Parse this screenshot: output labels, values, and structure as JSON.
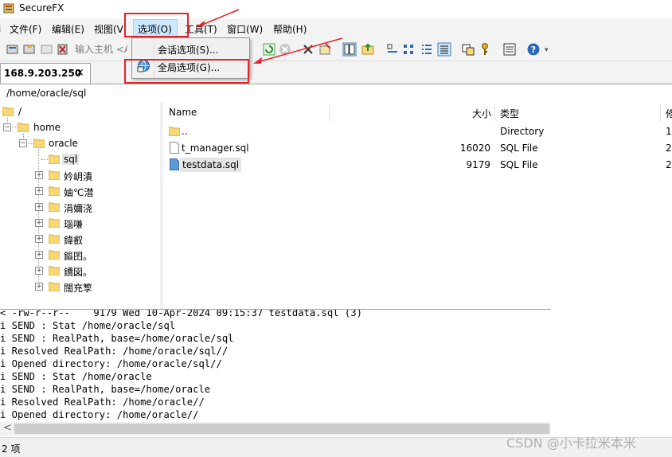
{
  "window": {
    "title": "SecureFX",
    "icon": "securefx-app-icon"
  },
  "menubar": {
    "items": [
      {
        "label": "文件(F)"
      },
      {
        "label": "编辑(E)"
      },
      {
        "label": "视图(V"
      },
      {
        "label": "选项(O)"
      },
      {
        "label": "工具(T)"
      },
      {
        "label": "窗口(W)"
      },
      {
        "label": "帮助(H)"
      }
    ]
  },
  "toolbar": {
    "host_placeholder": "输入主机 <A",
    "icons": [
      "connect-icon",
      "quick-connect-icon",
      "disconnect-icon",
      "delete-icon",
      "refresh-icon",
      "stop-icon",
      "delete-x-icon",
      "properties-icon",
      "view-panes-icon",
      "up-folder-icon",
      "large-icons-icon",
      "small-icons-icon",
      "list-view-icon",
      "details-view-icon",
      "sync-icon",
      "key-icon",
      "log-icon",
      "help-icon"
    ]
  },
  "dropdown": {
    "items": [
      {
        "label": "会话选项(S)..."
      },
      {
        "label": "全局选项(G)...",
        "icon": "global-options-icon"
      }
    ]
  },
  "tabs": [
    {
      "label": "168.9.203.250",
      "close": "×"
    }
  ],
  "path": "/home/oracle/sql",
  "tree": {
    "nodes": [
      {
        "label": "/"
      },
      {
        "label": "home"
      },
      {
        "label": "oracle"
      },
      {
        "label": "sql"
      },
      {
        "label": "妗岄潰"
      },
      {
        "label": "妯℃澘"
      },
      {
        "label": "涓嬭浇"
      },
      {
        "label": "瑙嗛"
      },
      {
        "label": "鍏叡"
      },
      {
        "label": "鏂囨。"
      },
      {
        "label": "鐨図。"
      },
      {
        "label": "闊充箰"
      }
    ]
  },
  "file_list": {
    "columns": [
      "Name",
      "大小",
      "类型",
      "修"
    ],
    "rows": [
      {
        "name": "..",
        "size": "",
        "type": "Directory",
        "extra": "1("
      },
      {
        "name": "t_manager.sql",
        "size": "16020",
        "type": "SQL File",
        "extra": "2("
      },
      {
        "name": "testdata.sql",
        "size": "9179",
        "type": "SQL File",
        "extra": "2("
      }
    ]
  },
  "log": {
    "lines": [
      "< -rw-r--r--    9179 Wed 10-Apr-2024 09:15:37 testdata.sql (3)",
      "i SEND : Stat /home/oracle/sql",
      "i SEND : RealPath, base=/home/oracle/sql",
      "i Resolved RealPath: /home/oracle/sql//",
      "i Opened directory: /home/oracle/sql//",
      "i SEND : Stat /home/oracle",
      "i SEND : RealPath, base=/home/oracle",
      "i Resolved RealPath: /home/oracle//",
      "i Opened directory: /home/oracle//"
    ]
  },
  "statusbar": {
    "text": "2 项"
  },
  "watermark": "CSDN @小卡拉米本米",
  "colors": {
    "annotation_red": "#e4232b",
    "folder_yellow": "#f8d775",
    "selection_blue": "#cce8ff"
  }
}
